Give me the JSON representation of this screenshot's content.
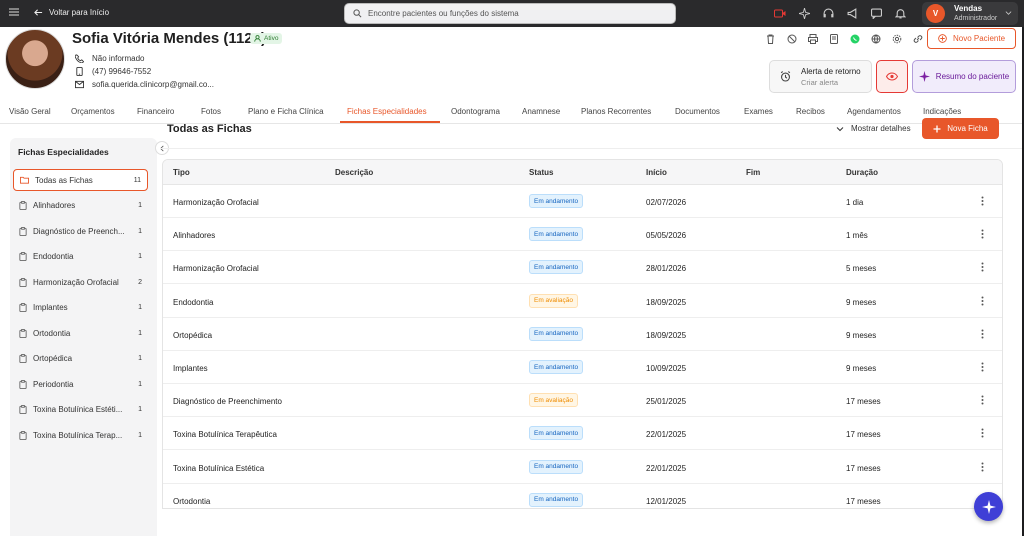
{
  "topbar": {
    "back_label": "Voltar para Início",
    "search_placeholder": "Encontre pacientes ou funções do sistema",
    "user_initial": "V",
    "user_name": "Vendas",
    "user_role": "Administrador"
  },
  "patient": {
    "name": "Sofia Vitória Mendes (1120)",
    "status": "Ativo",
    "info": "Não informado",
    "phone": "(47) 99646-7552",
    "email": "sofia.querida.clinicorp@gmail.co..."
  },
  "actions": {
    "novo_paciente": "Novo Paciente",
    "alerta_title": "Alerta de retorno",
    "alerta_sub": "Criar alerta",
    "resumo": "Resumo do paciente"
  },
  "tabs": [
    {
      "label": "Visão Geral"
    },
    {
      "label": "Orçamentos"
    },
    {
      "label": "Financeiro"
    },
    {
      "label": "Fotos"
    },
    {
      "label": "Plano e Ficha Clínica"
    },
    {
      "label": "Fichas Especialidades"
    },
    {
      "label": "Odontograma"
    },
    {
      "label": "Anamnese"
    },
    {
      "label": "Planos Recorrentes"
    },
    {
      "label": "Documentos"
    },
    {
      "label": "Exames"
    },
    {
      "label": "Recibos"
    },
    {
      "label": "Agendamentos"
    },
    {
      "label": "Indicações"
    }
  ],
  "sidebar": {
    "title": "Fichas Especialidades",
    "items": [
      {
        "label": "Todas as Fichas",
        "count": "11"
      },
      {
        "label": "Alinhadores",
        "count": "1"
      },
      {
        "label": "Diagnóstico de Preench...",
        "count": "1"
      },
      {
        "label": "Endodontia",
        "count": "1"
      },
      {
        "label": "Harmonização Orofacial",
        "count": "2"
      },
      {
        "label": "Implantes",
        "count": "1"
      },
      {
        "label": "Ortodontia",
        "count": "1"
      },
      {
        "label": "Ortopédica",
        "count": "1"
      },
      {
        "label": "Periodontia",
        "count": "1"
      },
      {
        "label": "Toxina Botulínica Estéti...",
        "count": "1"
      },
      {
        "label": "Toxina Botulínica Terap...",
        "count": "1"
      }
    ]
  },
  "content": {
    "title": "Todas as Fichas",
    "mostrar": "Mostrar detalhes",
    "nova_ficha": "Nova Ficha",
    "columns": {
      "tipo": "Tipo",
      "descricao": "Descrição",
      "status": "Status",
      "inicio": "Início",
      "fim": "Fim",
      "duracao": "Duração"
    },
    "rows": [
      {
        "tipo": "Harmonização Orofacial",
        "status": "Em andamento",
        "inicio": "02/07/2026",
        "duracao": "1 dia"
      },
      {
        "tipo": "Alinhadores",
        "status": "Em andamento",
        "inicio": "05/05/2026",
        "duracao": "1 mês"
      },
      {
        "tipo": "Harmonização Orofacial",
        "status": "Em andamento",
        "inicio": "28/01/2026",
        "duracao": "5 meses"
      },
      {
        "tipo": "Endodontia",
        "status": "Em avaliação",
        "inicio": "18/09/2025",
        "duracao": "9 meses"
      },
      {
        "tipo": "Ortopédica",
        "status": "Em andamento",
        "inicio": "18/09/2025",
        "duracao": "9 meses"
      },
      {
        "tipo": "Implantes",
        "status": "Em andamento",
        "inicio": "10/09/2025",
        "duracao": "9 meses"
      },
      {
        "tipo": "Diagnóstico de Preenchimento",
        "status": "Em avaliação",
        "inicio": "25/01/2025",
        "duracao": "17 meses"
      },
      {
        "tipo": "Toxina Botulínica Terapêutica",
        "status": "Em andamento",
        "inicio": "22/01/2025",
        "duracao": "17 meses"
      },
      {
        "tipo": "Toxina Botulínica Estética",
        "status": "Em andamento",
        "inicio": "22/01/2025",
        "duracao": "17 meses"
      },
      {
        "tipo": "Ortodontia",
        "status": "Em andamento",
        "inicio": "12/01/2025",
        "duracao": "17 meses"
      }
    ]
  },
  "colors": {
    "accent": "#e8572a",
    "topbar": "#2a2a2c",
    "fab": "#3f3fd6"
  }
}
